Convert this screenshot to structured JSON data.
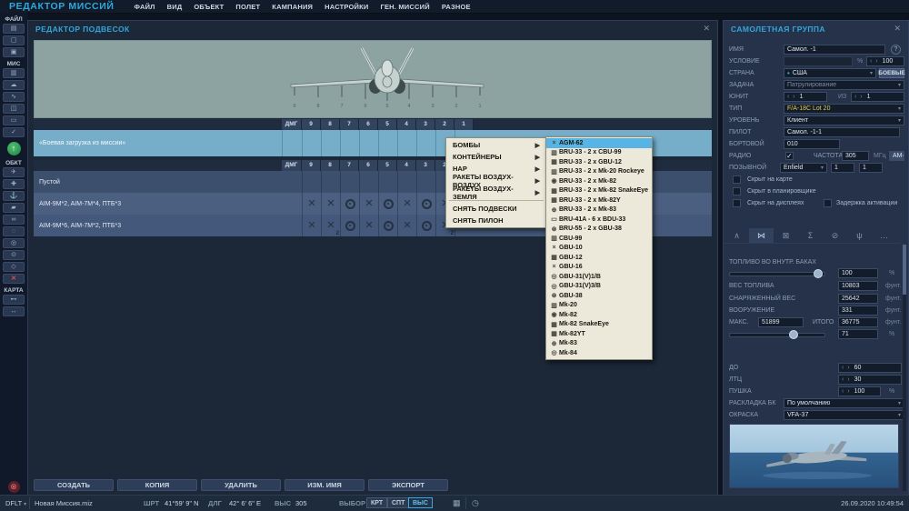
{
  "colors": {
    "accent": "#2fa8dc",
    "selection": "#58b4e4",
    "selected_row": "#76aec9",
    "aircraft_type_text": "#e3cf4e",
    "menu_bg": "#ece9da"
  },
  "topbar": {
    "title": "РЕДАКТОР МИССИЙ",
    "menu": [
      "ФАЙЛ",
      "ВИД",
      "ОБЪЕКТ",
      "ПОЛЕТ",
      "КАМПАНИЯ",
      "НАСТРОЙКИ",
      "ГЕН. МИССИЙ",
      "РАЗНОЕ"
    ]
  },
  "sidebar": {
    "sections": [
      {
        "label": "ФАЙЛ",
        "icons": [
          {
            "name": "new-mission-icon",
            "glyph": "▤"
          },
          {
            "name": "open-mission-icon",
            "glyph": "▢"
          },
          {
            "name": "save-mission-icon",
            "glyph": "▣"
          }
        ]
      },
      {
        "label": "МИС",
        "icons": [
          {
            "name": "briefing-icon",
            "glyph": "▥"
          },
          {
            "name": "weather-icon",
            "glyph": "☁"
          },
          {
            "name": "route-tool-icon",
            "glyph": "∿"
          },
          {
            "name": "mission-options-icon",
            "glyph": "◫"
          },
          {
            "name": "mission-goals-icon",
            "glyph": "▭"
          },
          {
            "name": "mission-check-icon",
            "glyph": "✓"
          }
        ]
      },
      {
        "label": "ОБКТ",
        "icons": [
          {
            "name": "aircraft-icon",
            "glyph": "✈"
          },
          {
            "name": "helicopter-icon",
            "glyph": "✚"
          },
          {
            "name": "ship-icon",
            "glyph": "⚓"
          },
          {
            "name": "vehicle-icon",
            "glyph": "▰"
          },
          {
            "name": "convoy-icon",
            "glyph": "∞"
          },
          {
            "name": "static-object-icon",
            "glyph": "◌"
          },
          {
            "name": "template-icon",
            "glyph": "◎"
          },
          {
            "name": "trigger-zone-icon",
            "glyph": "⊙"
          },
          {
            "name": "group-template-icon",
            "glyph": "◇"
          },
          {
            "name": "delete-object-icon",
            "glyph": "✕",
            "danger": true
          }
        ]
      },
      {
        "label": "КАРТА",
        "icons": [
          {
            "name": "measure-distance-icon",
            "glyph": "⊷"
          },
          {
            "name": "ruler-icon",
            "glyph": "↔"
          }
        ]
      }
    ],
    "fly_glyph": "↑",
    "exit_glyph": "⊗"
  },
  "payload_editor": {
    "title": "РЕДАКТОР ПОДВЕСОК",
    "close": "✕",
    "columns": [
      "ДМГ",
      "9",
      "8",
      "7",
      "6",
      "5",
      "4",
      "3",
      "2",
      "1"
    ],
    "mission_loadout": {
      "name": "«Боевая загрузка из миссии»",
      "cells": [
        "",
        "",
        "",
        "",
        "",
        "",
        "",
        "",
        "",
        ""
      ]
    },
    "loadouts": [
      {
        "name": "Пустой",
        "cells": [
          "",
          "",
          "",
          "",
          "",
          "",
          "",
          "",
          "",
          ""
        ]
      },
      {
        "name": "AIM-9M*2, AIM-7M*4, ПТБ*3",
        "cells": [
          "",
          "x",
          "x",
          "o",
          "x",
          "o",
          "x",
          "o",
          "x",
          "x"
        ]
      },
      {
        "name": "AIM-9M*6, AIM-7M*2, ПТБ*3",
        "cells": [
          "",
          "x",
          "x2",
          "o",
          "x",
          "o",
          "x",
          "o",
          "x2",
          "x"
        ]
      }
    ],
    "station_numbers": [
      "9",
      "8",
      "7",
      "6",
      "5",
      "4",
      "3",
      "2",
      "1"
    ],
    "buttons": [
      "СОЗДАТЬ",
      "КОПИЯ",
      "УДАЛИТЬ",
      "ИЗМ. ИМЯ",
      "ЭКСПОРТ"
    ]
  },
  "context_menu": {
    "items": [
      {
        "label": "БОМБЫ",
        "submenu": true
      },
      {
        "label": "КОНТЕЙНЕРЫ",
        "submenu": true
      },
      {
        "label": "НАР",
        "submenu": true
      },
      {
        "label": "РАКЕТЫ ВОЗДУХ-ВОЗДУХ",
        "submenu": true
      },
      {
        "label": "РАКЕТЫ ВОЗДУХ-ЗЕМЛЯ",
        "submenu": true
      },
      {
        "separator": true
      },
      {
        "label": "СНЯТЬ ПОДВЕСКИ"
      },
      {
        "label": "СНЯТЬ ПИЛОН"
      }
    ],
    "weapons": [
      {
        "label": "AGM-62",
        "icon": "×",
        "selected": true
      },
      {
        "label": "BRU-33 - 2 x CBU-99",
        "icon": "▥"
      },
      {
        "label": "BRU-33 - 2 x GBU-12",
        "icon": "▦"
      },
      {
        "label": "BRU-33 - 2 x Mk-20 Rockeye",
        "icon": "▥"
      },
      {
        "label": "BRU-33 - 2 x Mk-82",
        "icon": "◉"
      },
      {
        "label": "BRU-33 - 2 x Mk-82 SnakeEye",
        "icon": "▦"
      },
      {
        "label": "BRU-33 - 2 x Mk-82Y",
        "icon": "▦"
      },
      {
        "label": "BRU-33 - 2 x Mk-83",
        "icon": "⊕"
      },
      {
        "label": "BRU-41A - 6 x BDU-33",
        "icon": "▭"
      },
      {
        "label": "BRU-55 - 2 x GBU-38",
        "icon": "⊛"
      },
      {
        "label": "CBU-99",
        "icon": "▥"
      },
      {
        "label": "GBU-10",
        "icon": "×"
      },
      {
        "label": "GBU-12",
        "icon": "▦"
      },
      {
        "label": "GBU-16",
        "icon": "×"
      },
      {
        "label": "GBU-31(V)1/B",
        "icon": "◎"
      },
      {
        "label": "GBU-31(V)3/B",
        "icon": "◎"
      },
      {
        "label": "GBU-38",
        "icon": "⊛"
      },
      {
        "label": "Mk-20",
        "icon": "▥"
      },
      {
        "label": "Mk-82",
        "icon": "◉"
      },
      {
        "label": "Mk-82 SnakeEye",
        "icon": "▦"
      },
      {
        "label": "Mk-82YT",
        "icon": "▦"
      },
      {
        "label": "Mk-83",
        "icon": "⊕"
      },
      {
        "label": "Mk-84",
        "icon": "◎"
      }
    ]
  },
  "group_panel": {
    "title": "САМОЛЕТНАЯ ГРУППА",
    "close": "✕",
    "fields": {
      "name_label": "ИМЯ",
      "name_value": "Самол. -1",
      "help": "?",
      "condition_label": "УСЛОВИЕ",
      "condition_value": "",
      "percent": "%",
      "condition_prob": "100",
      "country_label": "СТРАНА",
      "country_value": "США",
      "coalition_button": "БОЕВЫЕ",
      "task_label": "ЗАДАЧА",
      "task_value": "Патрулирование",
      "unit_label": "ЮНИТ",
      "unit_value": "1",
      "of_label": "ИЗ",
      "unit_total": "1",
      "type_label": "ТИП",
      "type_value": "F/A-18C Lot 20",
      "skill_label": "УРОВЕНЬ",
      "skill_value": "Клиент",
      "pilot_label": "ПИЛОТ",
      "pilot_value": "Самол. -1-1",
      "board_label": "БОРТОВОЙ",
      "board_value": "010",
      "radio_label": "РАДИО",
      "radio_checked": true,
      "freq_label": "ЧАСТОТА",
      "freq_value": "305",
      "mhz_label": "МГц",
      "mod_value": "АМ",
      "callsign_label": "ПОЗЫВНОЙ",
      "callsign_value": "Enfield",
      "callsign_num1": "1",
      "callsign_num2": "1",
      "hidden_map": "Скрыт на карте",
      "hidden_planner": "Скрыт в планировщике",
      "hidden_mfd": "Скрыт на дисплеях",
      "late_activation": "Задержка активации"
    },
    "tabs": [
      {
        "name": "tab-route",
        "glyph": "∧"
      },
      {
        "name": "tab-payload",
        "glyph": "⋈",
        "active": true
      },
      {
        "name": "tab-equipment",
        "glyph": "⊠"
      },
      {
        "name": "tab-summary",
        "glyph": "Σ"
      },
      {
        "name": "tab-failures",
        "glyph": "⊘"
      },
      {
        "name": "tab-comms",
        "glyph": "ψ"
      },
      {
        "name": "tab-more",
        "glyph": "…"
      }
    ],
    "payload_tab": {
      "fuel_label": "ТОПЛИВО ВО ВНУТР. БАКАХ",
      "fuel_pct": "100",
      "pct": "%",
      "fuel_weight_label": "ВЕС ТОПЛИВА",
      "fuel_weight": "10803",
      "lbs": "фунт.",
      "empty_weight_label": "СНАРЯЖЕННЫЙ ВЕС",
      "empty_weight": "25642",
      "weapons_label": "ВООРУЖЕНИЕ",
      "weapons_weight": "331",
      "max_label": "МАКС.",
      "max_weight": "51899",
      "total_label": "ИТОГО",
      "total_weight": "36775",
      "load_pct": "71",
      "chaff_label": "ДО",
      "chaff_value": "60",
      "flare_label": "ЛТЦ",
      "flare_value": "30",
      "gun_label": "ПУШКА",
      "gun_value": "100",
      "ammo_label": "РАСКЛАДКА БК",
      "ammo_value": "По умолчанию",
      "livery_label": "ОКРАСКА",
      "livery_value": "VFA-37"
    }
  },
  "status_bar": {
    "profile": "DFLT",
    "mission": "Новая Миссия.miz",
    "lat_label": "ШРТ",
    "lat": "41°59' 9\" N",
    "lon_label": "ДЛГ",
    "lon": "42° 6' 6\" E",
    "alt_label": "ВЫС",
    "alt": "305",
    "select_label": "ВЫБОР",
    "map_btn": "КРТ",
    "sat_btn": "СПТ",
    "alt_btn": "ВЫС",
    "datetime": "26.09.2020 10:49:54"
  }
}
